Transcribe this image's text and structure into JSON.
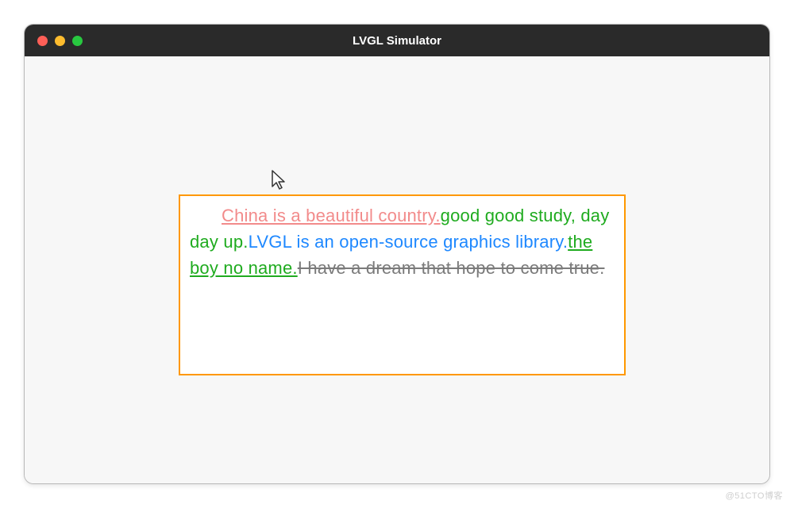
{
  "window": {
    "title": "LVGL Simulator"
  },
  "colors": {
    "border": "#ff9800",
    "seg1": "#f28b8b",
    "seg2": "#1fab1f",
    "seg3": "#1e88ff",
    "seg4": "#1fab1f",
    "seg5": "#7a7a7a"
  },
  "spans": {
    "seg1": "China is a beautiful country.",
    "seg2a": "good ",
    "seg2b": "good study, day day up.",
    "seg3": "LVGL is an open-source graphics library.",
    "seg4": "the boy no  name.",
    "seg5": "I have a dream that hope to  come true."
  },
  "watermark": "@51CTO博客"
}
